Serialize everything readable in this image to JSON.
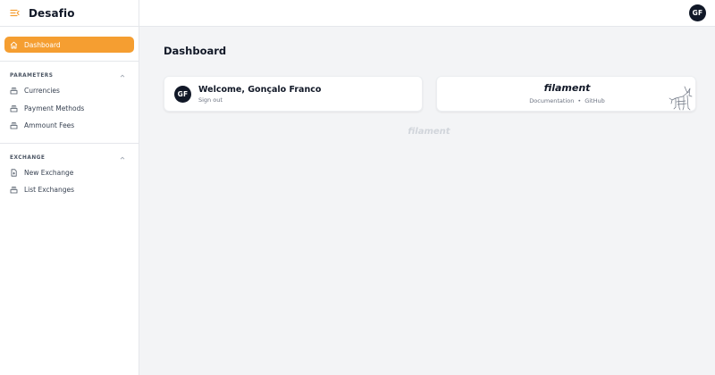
{
  "app": {
    "name": "Desafio",
    "accent_color": "#f59e31"
  },
  "user": {
    "initials": "GF",
    "name": "Gonçalo Franco"
  },
  "sidebar": {
    "dashboard_label": "Dashboard",
    "groups": [
      {
        "title": "PARAMETERS",
        "items": [
          {
            "label": "Currencies",
            "icon": "collection-icon"
          },
          {
            "label": "Payment Methods",
            "icon": "collection-icon"
          },
          {
            "label": "Ammount Fees",
            "icon": "collection-icon"
          }
        ]
      },
      {
        "title": "EXCHANGE",
        "items": [
          {
            "label": "New Exchange",
            "icon": "document-add-icon"
          },
          {
            "label": "List Exchanges",
            "icon": "collection-icon"
          }
        ]
      }
    ]
  },
  "main": {
    "title": "Dashboard",
    "welcome": {
      "text": "Welcome, Gonçalo Franco",
      "sign_out": "Sign out"
    },
    "filament": {
      "logo": "filament",
      "documentation": "Documentation",
      "separator": "•",
      "github": "GitHub"
    },
    "footer_logo": "filament"
  }
}
